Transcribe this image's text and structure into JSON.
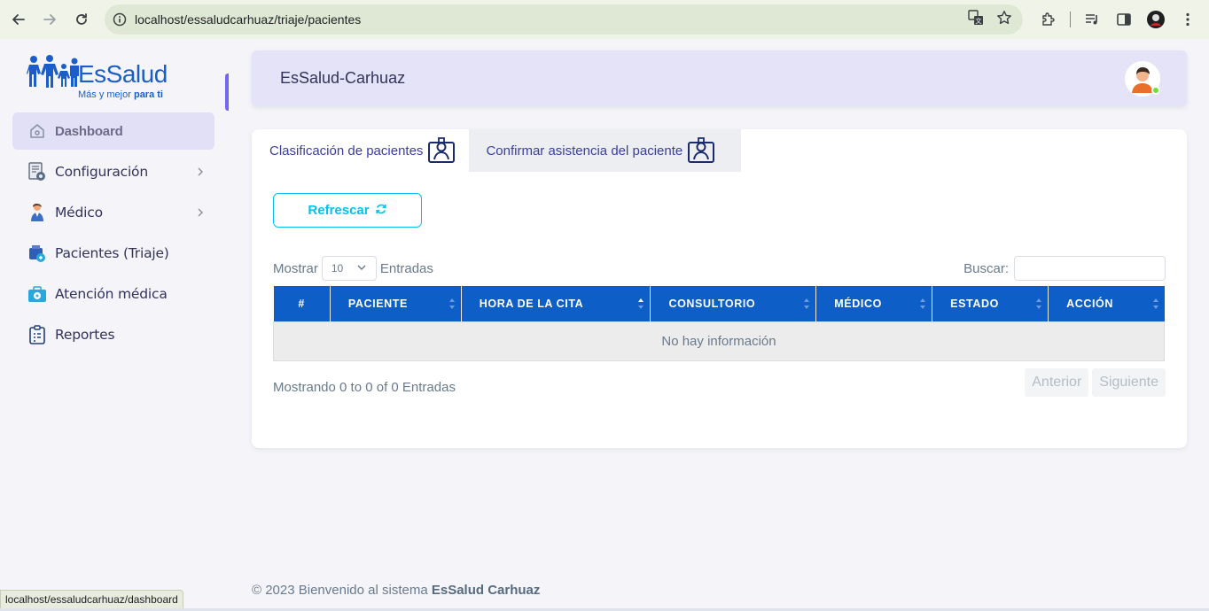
{
  "browser": {
    "url": "localhost/essaludcarhuaz/triaje/pacientes",
    "status_url": "localhost/essaludcarhuaz/dashboard"
  },
  "brand": {
    "name": "EsSalud",
    "tagline_prefix": "Más y mejor ",
    "tagline_emph": "para ti"
  },
  "sidebar": {
    "items": [
      {
        "label": "Dashboard",
        "icon": "home-icon",
        "active": true
      },
      {
        "label": "Configuración",
        "icon": "settings-doc-icon",
        "has_submenu": true
      },
      {
        "label": "Médico",
        "icon": "doctor-icon",
        "has_submenu": true
      },
      {
        "label": "Pacientes (Triaje)",
        "icon": "patients-icon"
      },
      {
        "label": "Atención médica",
        "icon": "medical-kit-icon"
      },
      {
        "label": "Reportes",
        "icon": "clipboard-icon"
      }
    ]
  },
  "header": {
    "title": "EsSalud-Carhuaz"
  },
  "tabs": [
    {
      "label": "Clasificación de pacientes",
      "active": true
    },
    {
      "label": "Confirmar asistencia del paciente",
      "active": false
    }
  ],
  "toolbar": {
    "refresh_label": "Refrescar"
  },
  "table_controls": {
    "show_label": "Mostrar",
    "page_size": "10",
    "entries_label": "Entradas",
    "search_label": "Buscar:"
  },
  "table": {
    "columns": [
      "#",
      "PACIENTE",
      "HORA DE LA CITA",
      "CONSULTORIO",
      "MÉDICO",
      "ESTADO",
      "ACCIÓN"
    ],
    "empty_message": "No hay información",
    "info": "Mostrando 0 to 0 of 0 Entradas",
    "prev_label": "Anterior",
    "next_label": "Siguiente"
  },
  "footer": {
    "prefix": "© 2023 Bienvenido al sistema ",
    "emph": "EsSalud Carhuaz"
  },
  "colors": {
    "accent": "#7367f0",
    "table_header": "#0d5fc7",
    "refresh": "#03c3ec",
    "online": "#71dd37"
  }
}
